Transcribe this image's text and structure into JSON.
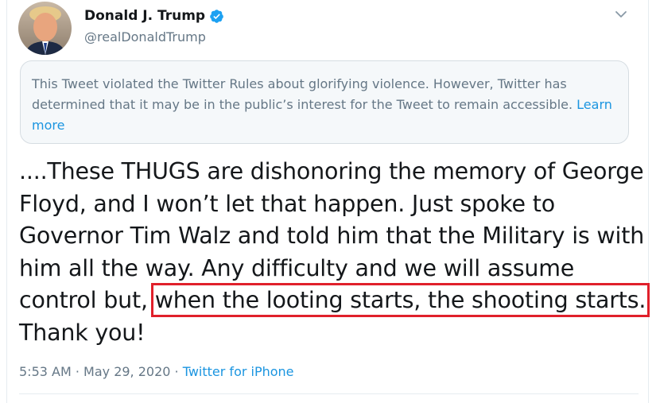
{
  "author": {
    "display_name": "Donald J. Trump",
    "handle": "@realDonaldTrump",
    "verified_icon": "verified-badge-icon",
    "avatar_icon": "profile-photo"
  },
  "menu": {
    "caret_icon": "chevron-down-icon"
  },
  "notice": {
    "text": "This Tweet violated the Twitter Rules about glorifying violence. However, Twitter has determined that it may be in the public’s interest for the Tweet to remain accessible.",
    "link_label": "Learn more"
  },
  "tweet": {
    "lines": [
      "....These THUGS are dishonoring the memory of George",
      "Floyd, and I won’t let that happen. Just spoke to",
      "Governor Tim Walz and told him that the Military is with",
      "him all the way. Any difficulty and we will assume",
      "control but, ",
      "Thank you!"
    ],
    "highlighted_text": "when the looting starts, the shooting starts."
  },
  "meta": {
    "time": "5:53 AM",
    "separator": " · ",
    "date": "May 29, 2020",
    "source": "Twitter for iPhone"
  },
  "colors": {
    "link": "#1b95e0",
    "highlight_box": "#e0202b",
    "verified": "#1da1f2",
    "secondary_text": "#657786"
  }
}
